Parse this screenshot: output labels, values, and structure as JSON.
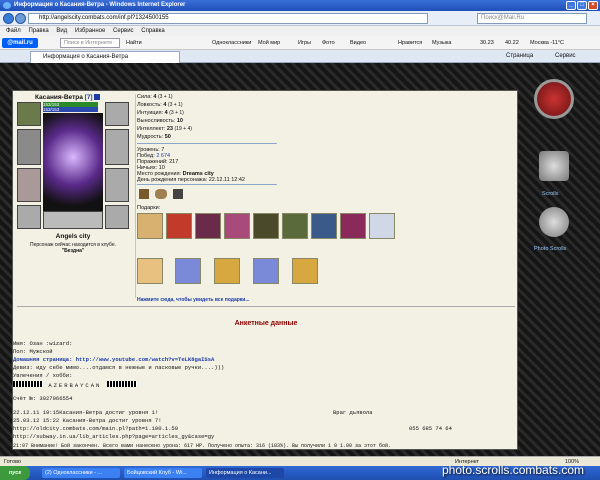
{
  "window": {
    "title": "Информация о Касания-Ветра - Windows Internet Explorer"
  },
  "address": {
    "url": "http://angelscity.combats.com/inf.pl?1324500155",
    "search_placeholder": "Поиск@Mail.Ru"
  },
  "menu": [
    "Файл",
    "Правка",
    "Вид",
    "Избранное",
    "Сервис",
    "Справка"
  ],
  "mailbar": {
    "logo": "@mail.ru",
    "search_placeholder": "Поиск в Интернете",
    "find": "Найти",
    "items": [
      "Одноклассники",
      "Мой мир",
      "Игры",
      "Фото",
      "Видео",
      "Нравится",
      "Музыка",
      "30.23",
      "40.22",
      "Москва -11°C"
    ]
  },
  "tab": {
    "title": "Информация о Касания-Ветра",
    "page": "Страница",
    "service": "Сервис"
  },
  "character": {
    "name": "Касания-Ветра",
    "level_badge": "[7]",
    "hp": "153/153",
    "mana": "153/153",
    "city": "Angels city",
    "location": "Персонаж сейчас находится в клубе.",
    "room": "\"Бездна\""
  },
  "stats": [
    {
      "label": "Сила:",
      "value": "4",
      "extra": "(3 + 1)"
    },
    {
      "label": "Ловкость:",
      "value": "4",
      "extra": "(3 + 1)"
    },
    {
      "label": "Интуиция:",
      "value": "4",
      "extra": "(3 + 1)"
    },
    {
      "label": "Выносливость:",
      "value": "10",
      "extra": ""
    },
    {
      "label": "Интеллект:",
      "value": "23",
      "extra": "(19 + 4)"
    },
    {
      "label": "Мудрость:",
      "value": "50",
      "extra": ""
    }
  ],
  "info": [
    {
      "label": "Уровень:",
      "value": "7"
    },
    {
      "label": "Побед:",
      "value": "2 674"
    },
    {
      "label": "Поражений:",
      "value": "217"
    },
    {
      "label": "Ничьих:",
      "value": "10"
    },
    {
      "label": "Место рождения:",
      "value": "Dreams city"
    },
    {
      "label": "День рождения персонажа:",
      "value": "22.12.11 12:42"
    }
  ],
  "gifts": {
    "label": "Подарки:",
    "more_link": "Нажмите сюда, чтобы увидеть все подарки..."
  },
  "right": {
    "scrolls": "Scrolls",
    "photo_scrolls": "Photo Scrolls"
  },
  "profile": {
    "header": "Анкетные данные",
    "lines": [
      "Имя: Озан :wizard:",
      "Пол: Мужской",
      "Домашняя страница: http://www.youtube.com/watch?v=TeLK8gaISsA",
      "Девиз: иду себе мимо....отдамся в нежные и ласковые ручки....)))",
      "Увлечения / хобби:",
      "AZERBAYCAN",
      "Счёт №: 3027066554"
    ],
    "log": [
      "22.12.11 19:15Касания-Ветра достиг уровня 1!",
      "25.03.12 15:22 Касания-Ветра достиг уровня 7!",
      "http://oldcity.combats.com/main.pl?path=1.100.1.50",
      "http://subway.in.ua/lib_articles.php?page=articles_gy&case=gy",
      "21:07 Внимание! Бой закончен. Всего вами нанесено урона: 617 HP. Получено опыта: 316 (183%). Вы получили 1 0 1.00 за этот бой."
    ],
    "enemy": "Враг дьявола",
    "phone": "055 685 74 64"
  },
  "statusbar": {
    "left": "Готово",
    "zone": "Интернет",
    "zoom": "100%"
  },
  "taskbar": {
    "start": "пуск",
    "tasks": [
      "(2) Одноклассники - ...",
      "Бойцовский Клуб - Wi...",
      "Информация о Касани..."
    ],
    "watermark": "photo.scrolls.combats.com"
  },
  "colors": {
    "accent_red": "#8b0000",
    "link_blue": "#1a3aa8",
    "taskbar": "#245edb"
  }
}
